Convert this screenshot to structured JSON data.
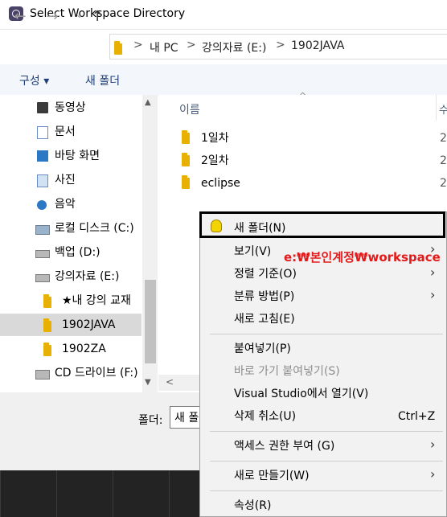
{
  "window": {
    "title": "Select Workspace Directory"
  },
  "address": {
    "crumbs": [
      "내 PC",
      "강의자료 (E:)",
      "1902JAVA"
    ],
    "separator": ">"
  },
  "nav_arrows": {
    "back": "←",
    "forward": "→",
    "dropdown": "⌄",
    "up": "↑"
  },
  "toolbar": {
    "organize": "구성 ▾",
    "new_folder": "새 폴더"
  },
  "sidebar": {
    "items": [
      {
        "label": "동영상",
        "icon": "video-icon"
      },
      {
        "label": "문서",
        "icon": "document-icon"
      },
      {
        "label": "바탕 화면",
        "icon": "desktop-icon"
      },
      {
        "label": "사진",
        "icon": "picture-icon"
      },
      {
        "label": "음악",
        "icon": "music-icon"
      },
      {
        "label": "로컬 디스크 (C:)",
        "icon": "windows-drive-icon"
      },
      {
        "label": "백업 (D:)",
        "icon": "drive-icon"
      },
      {
        "label": "강의자료 (E:)",
        "icon": "drive-icon"
      },
      {
        "label": "★내 강의 교재",
        "icon": "folder-icon"
      },
      {
        "label": "1902JAVA",
        "icon": "folder-icon",
        "selected": true
      },
      {
        "label": "1902ZA",
        "icon": "folder-icon"
      },
      {
        "label": "CD 드라이브 (F:)",
        "icon": "cd-drive-icon"
      }
    ]
  },
  "files": {
    "column_name": "이름",
    "column_2": "수",
    "rows": [
      {
        "name": "1일차",
        "date": "2"
      },
      {
        "name": "2일차",
        "date": "2"
      },
      {
        "name": "eclipse",
        "date": "2"
      }
    ]
  },
  "footer": {
    "folder_label": "폴더:",
    "folder_value": "새 폴더"
  },
  "context_menu": {
    "items": [
      {
        "label": "새 폴더(N)",
        "highlighted": true
      },
      {
        "label": "보기(V)",
        "submenu": true
      },
      {
        "label": "정렬 기준(O)",
        "submenu": true
      },
      {
        "label": "분류 방법(P)",
        "submenu": true
      },
      {
        "label": "새로 고침(E)"
      },
      {
        "label": "붙여넣기(P)"
      },
      {
        "label": "바로 가기 붙여넣기(S)",
        "disabled": true
      },
      {
        "label": "Visual Studio에서 열기(V)"
      },
      {
        "label": "삭제 취소(U)",
        "shortcut": "Ctrl+Z"
      },
      {
        "label": "액세스 권한 부여 (G)",
        "submenu": true
      },
      {
        "label": "새로 만들기(W)",
        "submenu": true
      },
      {
        "label": "속성(R)"
      }
    ]
  },
  "annotation": "e:₩본인계정₩workspace",
  "colors": {
    "accent": "#1e3f78",
    "annotation": "#e31a1a",
    "folder": "#e8b000",
    "selection": "#d9d9d9"
  }
}
